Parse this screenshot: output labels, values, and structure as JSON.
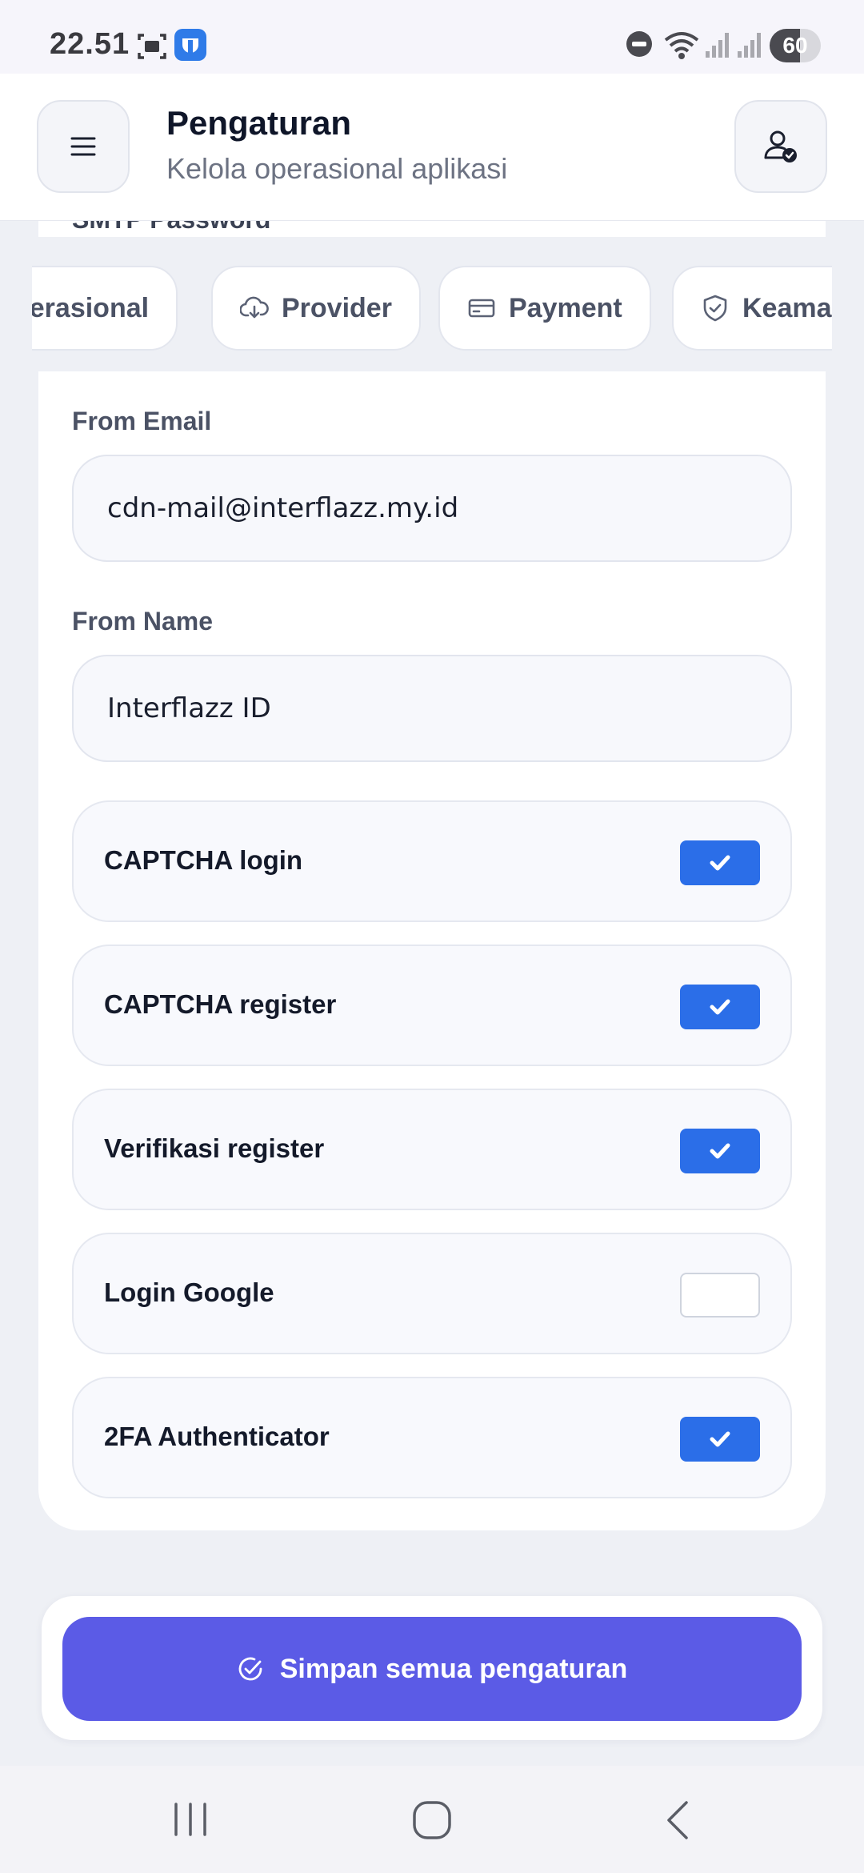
{
  "status_bar": {
    "time": "22.51",
    "battery": "60",
    "battery_level": 0.6
  },
  "header": {
    "title": "Pengaturan",
    "subtitle": "Kelola operasional aplikasi"
  },
  "cutoff_label": "SMTP Password",
  "tabs": [
    {
      "label": "perasional",
      "icon": "gear-icon"
    },
    {
      "label": "Provider",
      "icon": "cloud-download-icon"
    },
    {
      "label": "Payment",
      "icon": "credit-card-icon"
    },
    {
      "label": "Keama",
      "icon": "shield-check-icon"
    }
  ],
  "form": {
    "from_email": {
      "label": "From Email",
      "value": "cdn-mail@interflazz.my.id"
    },
    "from_name": {
      "label": "From Name",
      "value": "Interflazz ID"
    }
  },
  "toggles": [
    {
      "label": "CAPTCHA login",
      "checked": true
    },
    {
      "label": "CAPTCHA register",
      "checked": true
    },
    {
      "label": "Verifikasi register",
      "checked": true
    },
    {
      "label": "Login Google",
      "checked": false
    },
    {
      "label": "2FA Authenticator",
      "checked": true
    }
  ],
  "save_button": {
    "label": "Simpan semua pengaturan"
  },
  "colors": {
    "accent": "#5b5be6",
    "checkbox": "#2b6ee8",
    "background": "#eef0f5"
  }
}
